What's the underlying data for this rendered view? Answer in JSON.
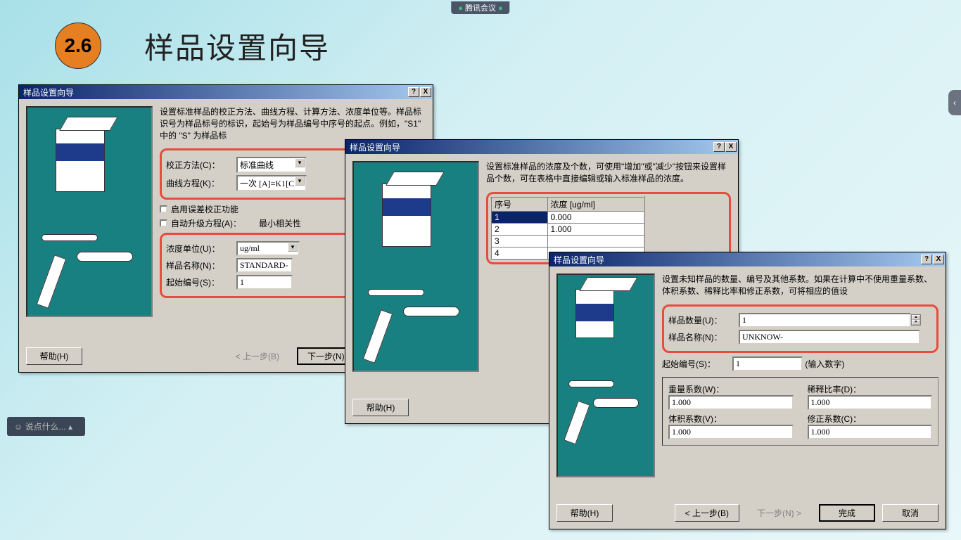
{
  "top": {
    "meeting": "腾讯会议"
  },
  "section": {
    "num": "2.6",
    "title": "样品设置向导"
  },
  "chat": "说点什么...",
  "sideTab": "‹",
  "windowTitle": "样品设置向导",
  "helpBtn": "?",
  "closeBtn": "X",
  "btns": {
    "help": "帮助(H)",
    "back": "< 上一步(B)",
    "next": "下一步(N) >",
    "finish": "完成",
    "cancel": "取消"
  },
  "d1": {
    "instr": "设置标准样品的校正方法、曲线方程、计算方法、浓度单位等。样品标识号为样品标号的标识，起始号为样品编号中序号的起点。例如，\"S1\" 中的 \"S\" 为样品标",
    "calibMethod": {
      "lbl": "校正方法(C)：",
      "val": "标准曲线"
    },
    "curve": {
      "lbl": "曲线方程(K)：",
      "val": "一次 [A]=K1[C"
    },
    "chk1": "启用误差校正功能",
    "chk2": {
      "lbl": "自动升级方程(A)：",
      "opt": "最小相关性"
    },
    "unit": {
      "lbl": "浓度单位(U)：",
      "val": "ug/ml"
    },
    "name": {
      "lbl": "样品名称(N)：",
      "val": "STANDARD-"
    },
    "start": {
      "lbl": "起始编号(S)：",
      "val": "1"
    }
  },
  "d2": {
    "instr": "设置标准样品的浓度及个数，可使用\"增加\"或\"减少\"按钮来设置样品个数，可在表格中直接编辑或输入标准样品的浓度。",
    "hdr1": "序号",
    "hdr2": "浓度 [ug/ml]",
    "rows": [
      {
        "n": "1",
        "c": "0.000"
      },
      {
        "n": "2",
        "c": "1.000"
      },
      {
        "n": "3",
        "c": ""
      },
      {
        "n": "4",
        "c": ""
      }
    ]
  },
  "d3": {
    "instr": "设置未知样品的数量、编号及其他系数。如果在计算中不使用重量系数、体积系数、稀释比率和修正系数，可将相应的值设",
    "qty": {
      "lbl": "样品数量(U)：",
      "val": "1"
    },
    "name": {
      "lbl": "样品名称(N)：",
      "val": "UNKNOW-"
    },
    "start": {
      "lbl": "起始编号(S)：",
      "val": "1",
      "hint": "(输入数字)"
    },
    "wt": {
      "lbl": "重量系数(W)：",
      "val": "1.000"
    },
    "dil": {
      "lbl": "稀释比率(D)：",
      "val": "1.000"
    },
    "vol": {
      "lbl": "体积系数(V)：",
      "val": "1.000"
    },
    "corr": {
      "lbl": "修正系数(C)：",
      "val": "1.000"
    }
  }
}
